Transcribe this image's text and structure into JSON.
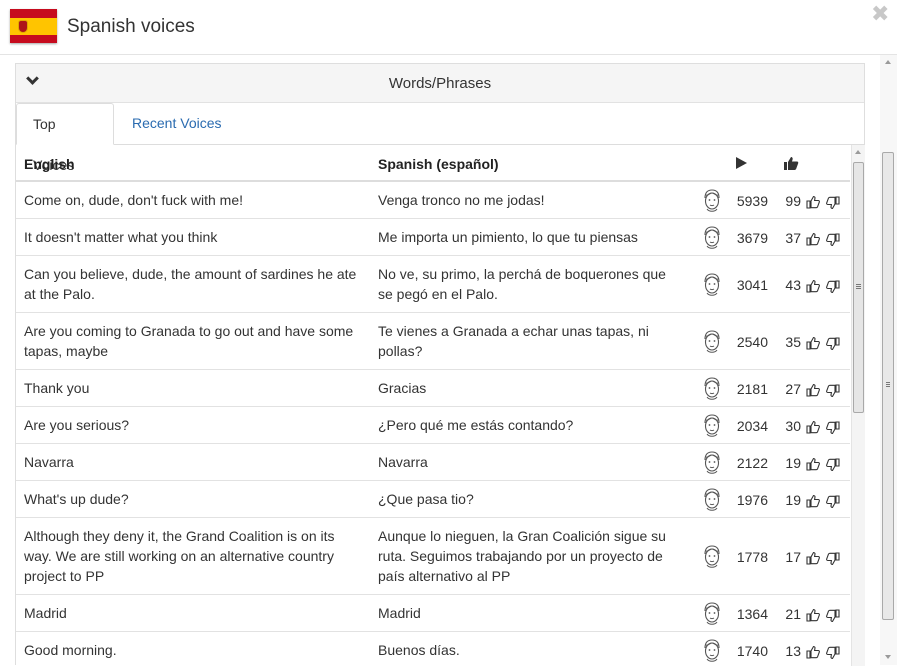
{
  "header": {
    "title": "Spanish voices",
    "close_symbol": "✖",
    "flag_icon": "spain-flag-icon"
  },
  "panel": {
    "title": "Words/Phrases",
    "collapse_icon": "chevron-down-icon"
  },
  "tabs": [
    {
      "label": "Top Voices",
      "active": true
    },
    {
      "label": "Recent Voices",
      "active": false
    }
  ],
  "table": {
    "columns": {
      "english": "English",
      "spanish": "Spanish (español)",
      "plays_icon": "play-icon",
      "votes_icon": "thumbs-up-icon"
    },
    "rows": [
      {
        "english": "Come on, dude, don't fuck with me!",
        "spanish": "Venga tronco no me jodas!",
        "plays": "5939",
        "votes": "99"
      },
      {
        "english": "It doesn't matter what you think",
        "spanish": "Me importa un pimiento, lo que tu piensas",
        "plays": "3679",
        "votes": "37"
      },
      {
        "english": "Can you believe, dude, the amount of sardines he ate at the Palo.",
        "spanish": "No ve, su primo, la perchá de boquerones que se pegó en el Palo.",
        "plays": "3041",
        "votes": "43"
      },
      {
        "english": "Are you coming to Granada to go out and have some tapas, maybe",
        "spanish": "Te vienes a Granada a echar unas tapas, ni pollas?",
        "plays": "2540",
        "votes": "35"
      },
      {
        "english": "Thank you",
        "spanish": "Gracias",
        "plays": "2181",
        "votes": "27"
      },
      {
        "english": "Are you serious?",
        "spanish": "¿Pero qué me estás contando?",
        "plays": "2034",
        "votes": "30"
      },
      {
        "english": "Navarra",
        "spanish": "Navarra",
        "plays": "2122",
        "votes": "19"
      },
      {
        "english": "What's up dude?",
        "spanish": "¿Que pasa tio?",
        "plays": "1976",
        "votes": "19"
      },
      {
        "english": "Although they deny it, the Grand Coalition is on its way. We are still working on an alternative country project to PP",
        "spanish": "Aunque lo nieguen, la Gran Coalición sigue su ruta. Seguimos trabajando por un proyecto de país alternativo al PP",
        "plays": "1778",
        "votes": "17"
      },
      {
        "english": "Madrid",
        "spanish": "Madrid",
        "plays": "1364",
        "votes": "21"
      },
      {
        "english": "Good morning.",
        "spanish": "Buenos días.",
        "plays": "1740",
        "votes": "13"
      }
    ]
  }
}
